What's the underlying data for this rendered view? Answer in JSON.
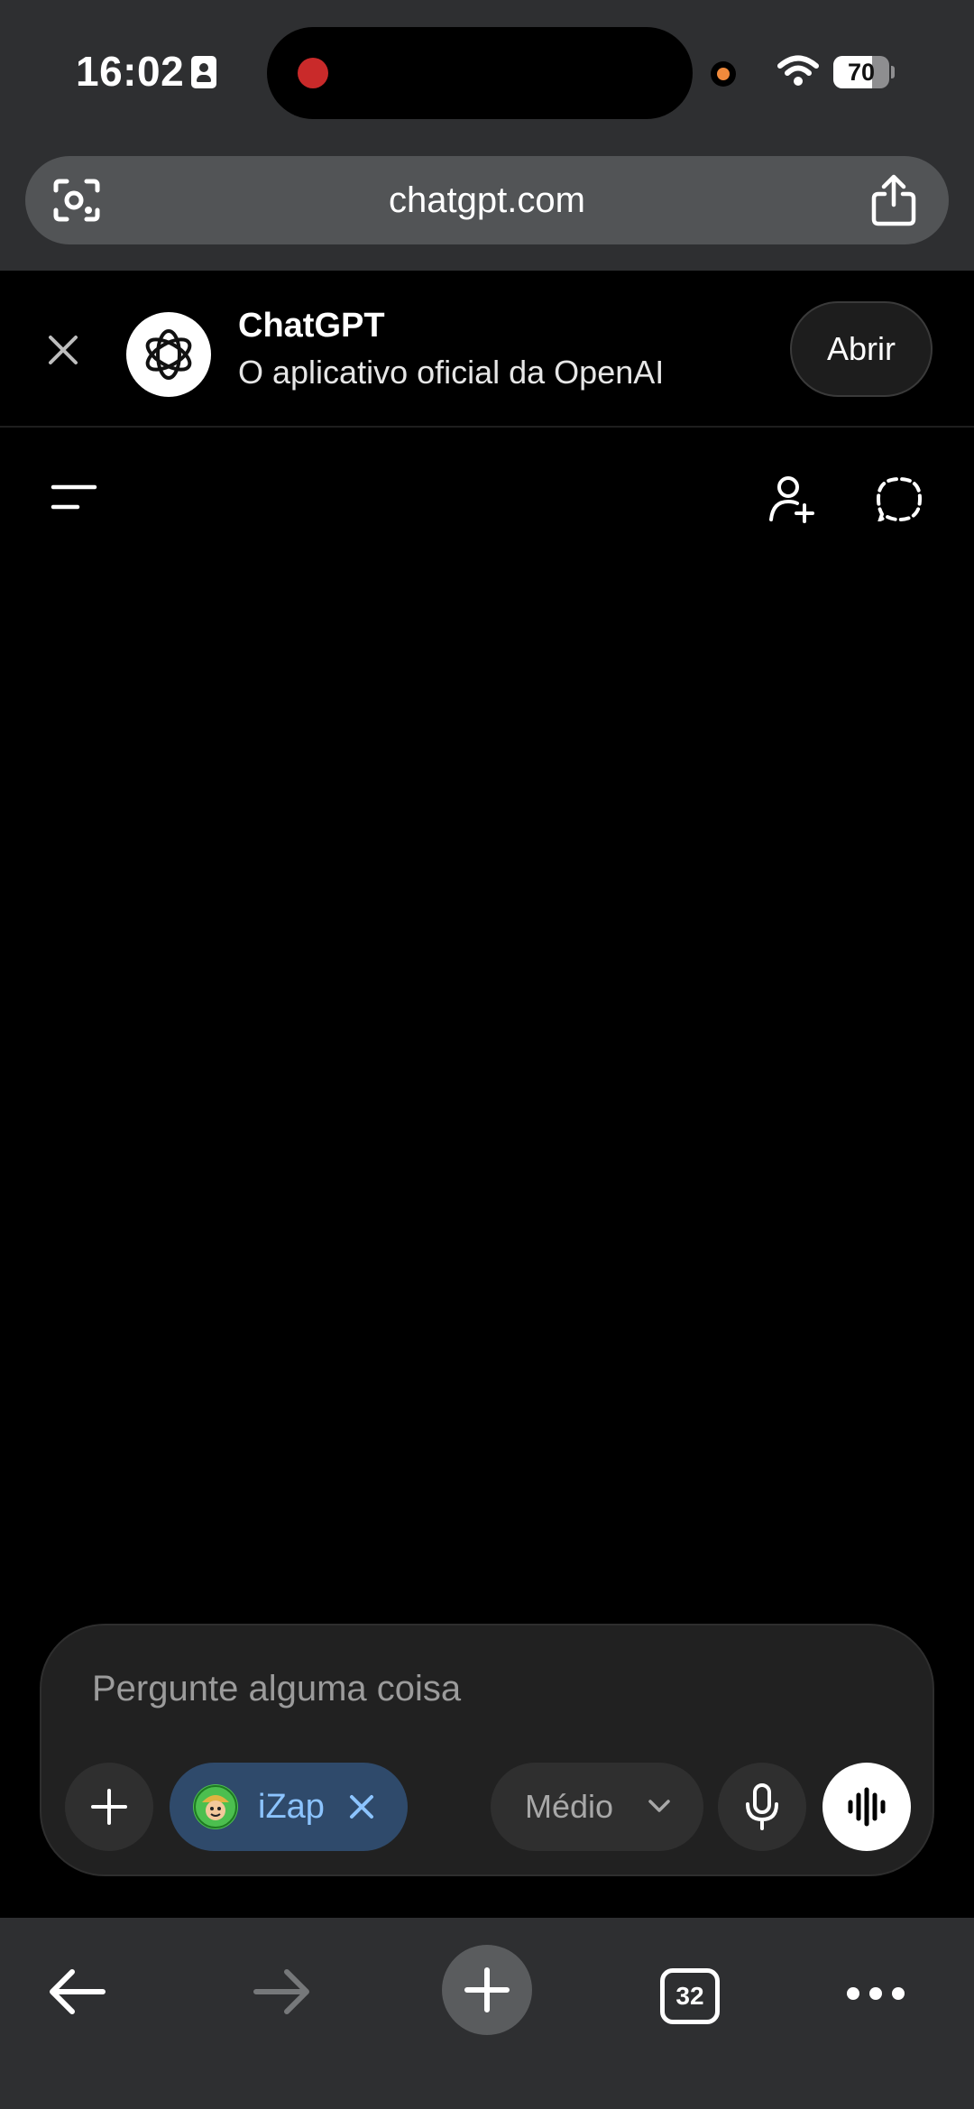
{
  "status_bar": {
    "time": "16:02",
    "battery_percent": 70,
    "battery_label": "70",
    "icons": [
      "contact-card-icon",
      "recording-dot-icon",
      "camera-indicator-icon",
      "wifi-icon",
      "battery-icon"
    ]
  },
  "browser": {
    "url": "chatgpt.com",
    "tab_count": "32",
    "icons": [
      "lens-icon",
      "share-icon",
      "back-arrow-icon",
      "forward-arrow-icon",
      "plus-icon",
      "more-icon"
    ]
  },
  "app_banner": {
    "title": "ChatGPT",
    "subtitle": "O aplicativo oficial da OpenAI",
    "open_label": "Abrir"
  },
  "chat_header": {
    "icons": [
      "menu-icon",
      "add-user-icon",
      "temporary-chat-icon"
    ]
  },
  "composer": {
    "placeholder": "Pergunte alguma coisa",
    "chip_label": "iZap",
    "model_label": "Médio"
  },
  "colors": {
    "page_background": "#000000",
    "chrome_background": "#2e2f31",
    "composer_background": "#212121",
    "chip_background": "#2f4a6b",
    "chip_text": "#8cc4ff",
    "recording_red": "#c92a2a"
  }
}
